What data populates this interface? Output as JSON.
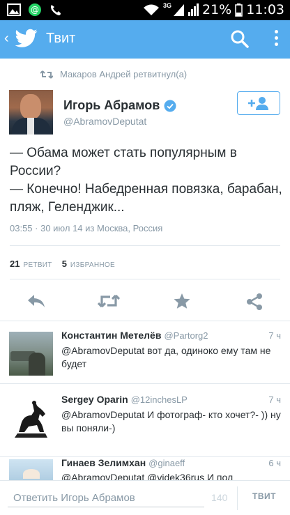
{
  "status_bar": {
    "network_label": "3G",
    "battery": "21%",
    "time": "11:03"
  },
  "action_bar": {
    "title": "Твит"
  },
  "tweet": {
    "retweeted_by": "Макаров Андрей ретвитнул(а)",
    "author_name": "Игорь Абрамов",
    "author_handle": "@AbramovDeputat",
    "text": "— Обама может стать популярным в России?\n— Конечно! Набедренная повязка, барабан, пляж, Геленджик...",
    "time": "03:55 · 30 июл 14",
    "location": "из Москва, Россия",
    "retweet_count": "21",
    "retweet_label": "РЕТВИТ",
    "favorite_count": "5",
    "favorite_label": "ИЗБРАННОЕ"
  },
  "replies": [
    {
      "name": "Константин Метелёв",
      "handle": "@Partorg2",
      "time": "7 ч",
      "text": "@AbramovDeputat вот да, одиноко ему там не будет"
    },
    {
      "name": "Sergey Oparin",
      "handle": "@12inchesLP",
      "time": "7 ч",
      "text": "@AbramovDeputat И фотограф- кто хочет?- )) ну вы поняли-)"
    },
    {
      "name": "Гинаев Зелимхан",
      "handle": "@ginaeff",
      "time": "6 ч",
      "text": "@AbramovDeputat @videk36rus И пол"
    }
  ],
  "compose": {
    "placeholder": "Ответить Игорь Абрамов",
    "char_count": "140",
    "button_label": "ТВИТ"
  },
  "colors": {
    "brand": "#55acee",
    "text": "#292f33",
    "muted": "#8899a6"
  }
}
